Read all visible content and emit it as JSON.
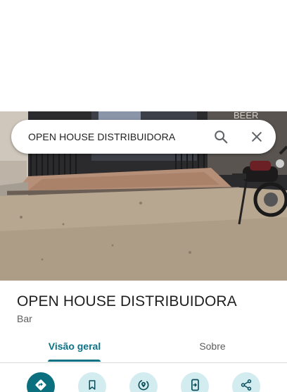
{
  "search": {
    "query": "OPEN HOUSE DISTRIBUIDORA",
    "search_icon": "search-icon",
    "close_icon": "close-icon"
  },
  "photo": {
    "sign_text": "BEER"
  },
  "place": {
    "name": "OPEN HOUSE DISTRIBUIDORA",
    "category": "Bar"
  },
  "tabs": [
    {
      "label": "Visão geral",
      "active": true
    },
    {
      "label": "Sobre",
      "active": false
    }
  ],
  "actions": [
    {
      "icon": "directions-icon"
    },
    {
      "icon": "bookmark-icon"
    },
    {
      "icon": "nearby-icon"
    },
    {
      "icon": "send-to-phone-icon"
    },
    {
      "icon": "share-icon"
    }
  ],
  "colors": {
    "accent": "#0b7285",
    "action_bg": "#d3ecf0",
    "primary_action_bg": "#0b6f7e"
  }
}
